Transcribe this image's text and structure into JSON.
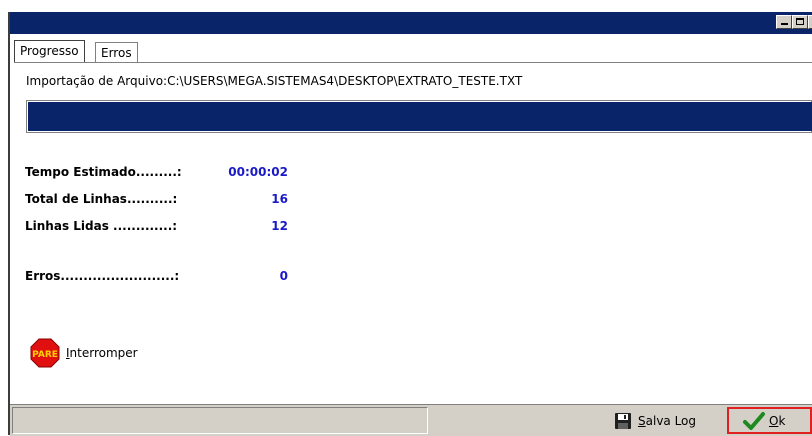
{
  "window": {
    "minimize_icon": "minimize-icon",
    "maximize_icon": "maximize-icon",
    "close_icon": "close-icon",
    "titlebar_color": "#0a246a"
  },
  "tabs": [
    {
      "label": "Progresso",
      "active": true
    },
    {
      "label": "Erros",
      "active": false
    }
  ],
  "import_path": "Importação de Arquivo:C:\\USERS\\MEGA.SISTEMAS4\\DESKTOP\\EXTRATO_TESTE.TXT",
  "progress": {
    "fraction": 1.0,
    "color": "#0a246a"
  },
  "stats": {
    "tempo_label": "Tempo Estimado.........:",
    "tempo_value": "00:00:02",
    "total_label": "Total de Linhas..........:",
    "total_value": "16",
    "lidas_label": "Linhas Lidas .............:",
    "lidas_value": "12",
    "erros_label": "Erros.........................:",
    "erros_value": "0",
    "value_color": "#1a1ac8"
  },
  "stop": {
    "icon": "pare-stop-icon",
    "icon_text": "PARE",
    "label": "Interromper"
  },
  "footer": {
    "save_log_icon": "floppy-disk-icon",
    "save_log_label": "Salva Log",
    "ok_icon": "checkmark-icon",
    "ok_label": "Ok",
    "ok_highlight_color": "#e02020"
  }
}
